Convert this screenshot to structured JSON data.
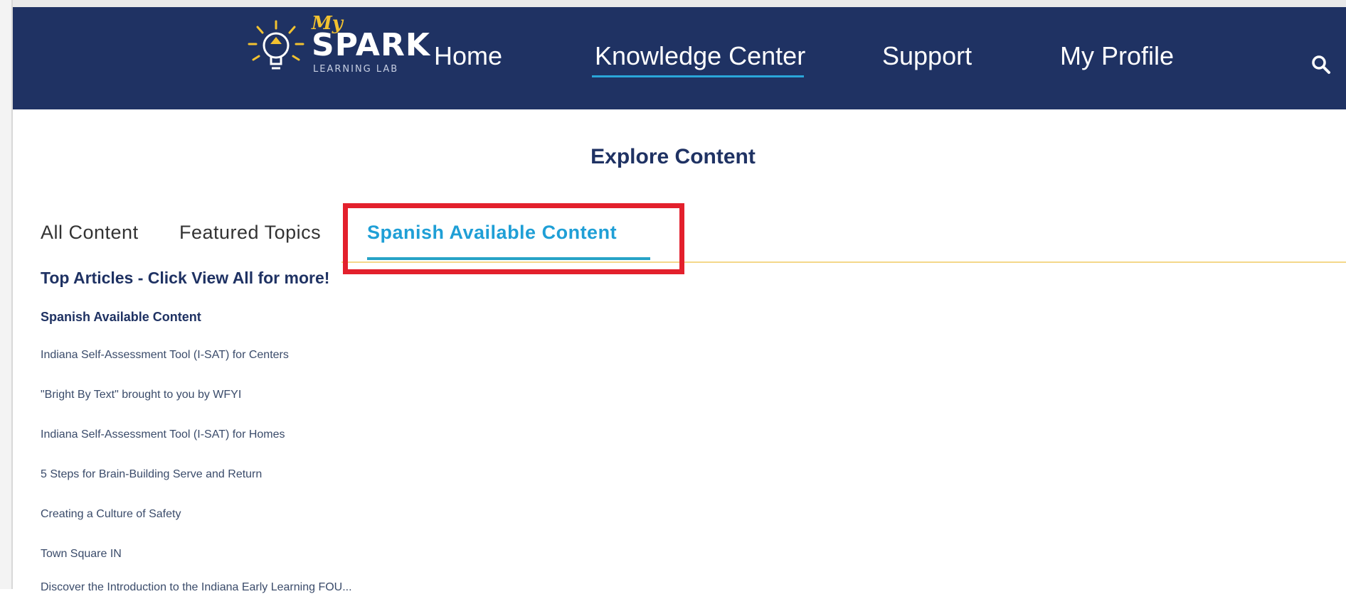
{
  "logo": {
    "my": "My",
    "name": "SPARK",
    "subtitle": "LEARNING LAB"
  },
  "nav": {
    "items": [
      {
        "label": "Home"
      },
      {
        "label": "Knowledge Center",
        "active": true
      },
      {
        "label": "Support"
      },
      {
        "label": "My Profile"
      }
    ],
    "search_icon": "search-icon"
  },
  "content": {
    "title": "Explore Content",
    "tabs": [
      {
        "label": "All Content"
      },
      {
        "label": "Featured Topics"
      },
      {
        "label": "Spanish Available Content",
        "active": true
      }
    ],
    "top_articles_header": "Top Articles - Click View All for more!",
    "subheader": "Spanish Available Content",
    "articles": [
      "Indiana Self-Assessment Tool (I-SAT) for Centers",
      "\"Bright By Text\" brought to you by WFYI",
      "Indiana Self-Assessment Tool (I-SAT) for Homes",
      "5 Steps for Brain-Building Serve and Return",
      "Creating a Culture of Safety",
      "Town Square IN",
      "Discover the Introduction to the Indiana Early Learning FOU..."
    ]
  },
  "colors": {
    "navbar": "#1f3263",
    "accent": "#1f9fd6",
    "highlight_box": "#e3202c",
    "tab_rule": "#f4d88a"
  }
}
